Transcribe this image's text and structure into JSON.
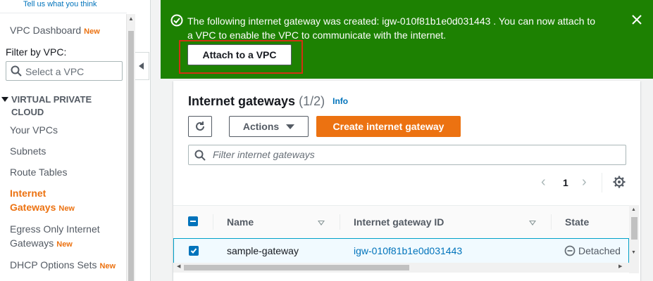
{
  "sidebar": {
    "feedback_link": "Tell us what you think",
    "dashboard": {
      "label": "VPC Dashboard",
      "badge": "New"
    },
    "filter_label": "Filter by VPC:",
    "filter_placeholder": "Select a VPC",
    "section_title_line1": "VIRTUAL PRIVATE",
    "section_title_line2": "CLOUD",
    "items": {
      "your_vpcs": "Your VPCs",
      "subnets": "Subnets",
      "route_tables": "Route Tables",
      "igw_line1": "Internet",
      "igw_line2": "Gateways",
      "igw_badge": "New",
      "egress_line1": "Egress Only Internet",
      "egress_line2": "Gateways",
      "egress_badge": "New",
      "dhcp": "DHCP Options Sets",
      "dhcp_badge": "New"
    }
  },
  "flash": {
    "message_line1": "The following internet gateway was created: igw-010f81b1e0d031443 . You can now attach to",
    "message_line2": "a VPC to enable the VPC to communicate with the internet.",
    "attach_button": "Attach to a VPC",
    "color": "#1d8102"
  },
  "panel": {
    "title": "Internet gateways",
    "count": "(1/2)",
    "info": "Info",
    "actions_button": "Actions",
    "create_button": "Create internet gateway",
    "filter_placeholder": "Filter internet gateways",
    "page_number": "1",
    "columns": {
      "name": "Name",
      "id": "Internet gateway ID",
      "state": "State"
    },
    "rows": [
      {
        "name": "sample-gateway",
        "id": "igw-010f81b1e0d031443",
        "state": "Detached",
        "selected": true
      }
    ]
  },
  "colors": {
    "accent": "#ec7211",
    "link": "#0073bb",
    "select": "#0073bb"
  }
}
